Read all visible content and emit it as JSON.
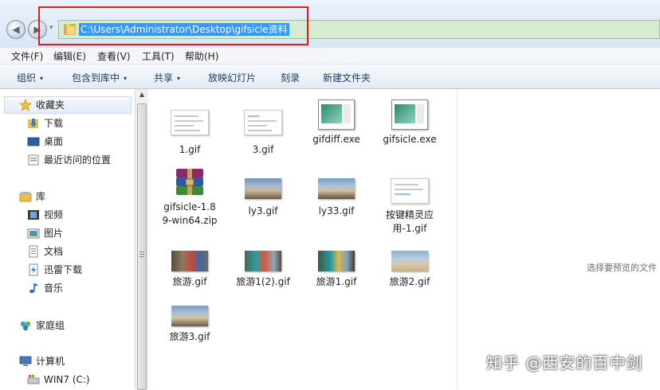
{
  "address_bar": {
    "path": "C:\\Users\\Administrator\\Desktop\\gifsicle资料",
    "back_glyph": "◀",
    "forward_glyph": "▶",
    "dropdown_glyph": "▾"
  },
  "menu": [
    "文件(F)",
    "编辑(E)",
    "查看(V)",
    "工具(T)",
    "帮助(H)"
  ],
  "toolbar": {
    "organize": "组织",
    "include_library": "包含到库中",
    "share": "共享",
    "slideshow": "放映幻灯片",
    "burn": "刻录",
    "new_folder": "新建文件夹",
    "caret": "▾"
  },
  "nav": {
    "favorites": "收藏夹",
    "download": "下载",
    "desktop": "桌面",
    "recent": "最近访问的位置",
    "libraries": "库",
    "video": "视频",
    "pictures": "图片",
    "documents": "文档",
    "thunder": "迅雷下载",
    "music": "音乐",
    "homegroup": "家庭组",
    "computer": "计算机",
    "drive_c": "WIN7 (C:)"
  },
  "files": [
    {
      "name": "1.gif",
      "kind": "doc"
    },
    {
      "name": "3.gif",
      "kind": "doc"
    },
    {
      "name": "gifdiff.exe",
      "kind": "app"
    },
    {
      "name": "gifsicle.exe",
      "kind": "app"
    },
    {
      "name": "gifsicle-1.89-win64.zip",
      "kind": "zip"
    },
    {
      "name": "ly3.gif",
      "kind": "photo"
    },
    {
      "name": "ly33.gif",
      "kind": "photo"
    },
    {
      "name": "按键精灵应用-1.gif",
      "kind": "doc"
    },
    {
      "name": "旅游.gif",
      "kind": "photo"
    },
    {
      "name": "旅游1(2).gif",
      "kind": "photo"
    },
    {
      "name": "旅游1.gif",
      "kind": "photo"
    },
    {
      "name": "旅游2.gif",
      "kind": "photo"
    },
    {
      "name": "旅游3.gif",
      "kind": "photo"
    }
  ],
  "preview": {
    "message": "选择要预览的文件"
  },
  "watermark": "知乎 @西安的百中剑",
  "colors": {
    "selection": "#3399ff",
    "highlight_box": "#d9201c",
    "address_bg": "#d6ecd0"
  }
}
